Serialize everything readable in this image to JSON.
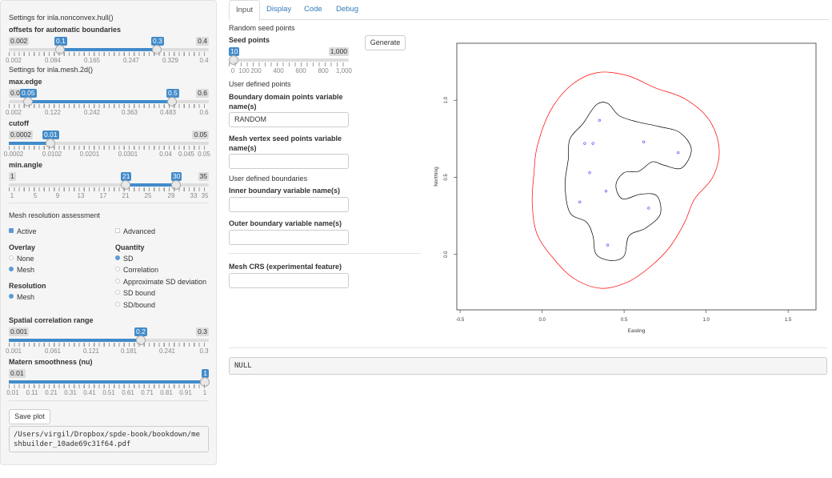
{
  "sidebar": {
    "hull_heading": "Settings for inla.nonconvex.hull()",
    "offsets": {
      "label": "offsets for automatic boundaries",
      "min": "0.002",
      "max": "0.4",
      "low": "0.1",
      "high": "0.3",
      "ticks": [
        "0.002",
        "0.084",
        "0.165",
        "0.247",
        "0.329",
        "0.4"
      ]
    },
    "mesh_heading": "Settings for inla.mesh.2d()",
    "max_edge": {
      "label": "max.edge",
      "min": "0.002",
      "max": "0.6",
      "low": "0.05",
      "high": "0.5",
      "ticks": [
        "0.002",
        "0.122",
        "0.242",
        "0.363",
        "0.483",
        "0.6"
      ]
    },
    "cutoff": {
      "label": "cutoff",
      "min": "0.0002",
      "max": "0.05",
      "value": "0.01",
      "ticks": [
        "0.0002",
        "0.0102",
        "0.0201",
        "0.0301",
        "0.04",
        "0.045",
        "0.05"
      ]
    },
    "min_angle": {
      "label": "min.angle",
      "min": "1",
      "max": "35",
      "low": "21",
      "high": "30",
      "ticks": [
        "1",
        "5",
        "9",
        "13",
        "17",
        "21",
        "25",
        "29",
        "33",
        "35"
      ]
    },
    "assessment_heading": "Mesh resolution assessment",
    "active_label": "Active",
    "advanced_label": "Advanced",
    "overlay_label": "Overlay",
    "overlay_options": [
      "None",
      "Mesh"
    ],
    "quantity_label": "Quantity",
    "quantity_options": [
      "SD",
      "Correlation",
      "Approximate SD deviation",
      "SD bound",
      "SD/bound"
    ],
    "resolution_label": "Resolution",
    "resolution_options": [
      "Mesh"
    ],
    "spatial_range": {
      "label": "Spatial correlation range",
      "min": "0.001",
      "max": "0.3",
      "value": "0.2",
      "ticks": [
        "0.001",
        "0.061",
        "0.121",
        "0.181",
        "0.241",
        "0.3"
      ]
    },
    "matern": {
      "label": "Matern smoothness (nu)",
      "min": "0.01",
      "value": "1",
      "ticks": [
        "0.01",
        "0.11",
        "0.21",
        "0.31",
        "0.41",
        "0.51",
        "0.61",
        "0.71",
        "0.81",
        "0.91",
        "1"
      ]
    },
    "save_plot_label": "Save plot",
    "save_path": "/Users/virgil/Dropbox/spde-book/bookdown/meshbuilder_10ade69c31f64.pdf"
  },
  "tabs": [
    "Input",
    "Display",
    "Code",
    "Debug"
  ],
  "main": {
    "random_heading": "Random seed points",
    "seed_label": "Seed points",
    "seed_min": "10",
    "seed_max": "1,000",
    "seed_ticks": [
      "0",
      "100",
      "200",
      "400",
      "600",
      "800",
      "1,000"
    ],
    "generate_label": "Generate",
    "user_points_heading": "User defined points",
    "boundary_var_label": "Boundary domain points variable name(s)",
    "boundary_var_value": "RANDOM",
    "mesh_vertex_label": "Mesh vertex seed points variable name(s)",
    "mesh_vertex_value": "",
    "user_boundaries_heading": "User defined boundaries",
    "inner_label": "Inner boundary variable name(s)",
    "inner_value": "",
    "outer_label": "Outer boundary variable name(s)",
    "outer_value": "",
    "crs_label": "Mesh CRS (experimental feature)",
    "crs_value": "",
    "output_text": "NULL"
  },
  "chart_data": {
    "type": "scatter",
    "xlabel": "Easting",
    "ylabel": "Northing",
    "xticks": [
      "-0.5",
      "0.0",
      "0.5",
      "1.0",
      "1.5"
    ],
    "yticks": [
      "0.0",
      "0.5",
      "1.0"
    ],
    "xlim": [
      -0.52,
      1.67
    ],
    "ylim": [
      -0.36,
      1.37
    ],
    "points": [
      [
        0.35,
        0.87
      ],
      [
        0.26,
        0.72
      ],
      [
        0.31,
        0.72
      ],
      [
        0.62,
        0.73
      ],
      [
        0.83,
        0.66
      ],
      [
        0.29,
        0.53
      ],
      [
        0.39,
        0.41
      ],
      [
        0.23,
        0.34
      ],
      [
        0.65,
        0.3
      ],
      [
        0.4,
        0.06
      ]
    ],
    "point_color": "#4040ff",
    "inner_boundary_color": "#000000",
    "outer_boundary_color": "#ff0000",
    "inner_boundary": [
      [
        0.14,
        0.45
      ],
      [
        0.16,
        0.62
      ],
      [
        0.17,
        0.75
      ],
      [
        0.25,
        0.85
      ],
      [
        0.33,
        0.97
      ],
      [
        0.4,
        0.98
      ],
      [
        0.47,
        0.9
      ],
      [
        0.58,
        0.86
      ],
      [
        0.71,
        0.83
      ],
      [
        0.84,
        0.79
      ],
      [
        0.91,
        0.68
      ],
      [
        0.85,
        0.56
      ],
      [
        0.74,
        0.58
      ],
      [
        0.67,
        0.6
      ],
      [
        0.59,
        0.54
      ],
      [
        0.5,
        0.53
      ],
      [
        0.45,
        0.45
      ],
      [
        0.49,
        0.36
      ],
      [
        0.6,
        0.39
      ],
      [
        0.7,
        0.38
      ],
      [
        0.72,
        0.26
      ],
      [
        0.63,
        0.17
      ],
      [
        0.53,
        0.12
      ],
      [
        0.5,
        -0.01
      ],
      [
        0.42,
        -0.04
      ],
      [
        0.33,
        0.0
      ],
      [
        0.31,
        0.12
      ],
      [
        0.27,
        0.21
      ],
      [
        0.17,
        0.27
      ],
      [
        0.14,
        0.45
      ]
    ],
    "outer_boundary": [
      [
        -0.06,
        0.33
      ],
      [
        -0.05,
        0.52
      ],
      [
        -0.03,
        0.7
      ],
      [
        0.05,
        0.93
      ],
      [
        0.18,
        1.1
      ],
      [
        0.34,
        1.18
      ],
      [
        0.52,
        1.16
      ],
      [
        0.69,
        1.08
      ],
      [
        0.87,
        1.01
      ],
      [
        1.02,
        0.87
      ],
      [
        1.08,
        0.68
      ],
      [
        1.04,
        0.5
      ],
      [
        0.93,
        0.36
      ],
      [
        0.87,
        0.21
      ],
      [
        0.78,
        0.05
      ],
      [
        0.66,
        -0.08
      ],
      [
        0.52,
        -0.18
      ],
      [
        0.36,
        -0.22
      ],
      [
        0.2,
        -0.16
      ],
      [
        0.08,
        -0.04
      ],
      [
        -0.03,
        0.13
      ],
      [
        -0.06,
        0.33
      ]
    ]
  }
}
